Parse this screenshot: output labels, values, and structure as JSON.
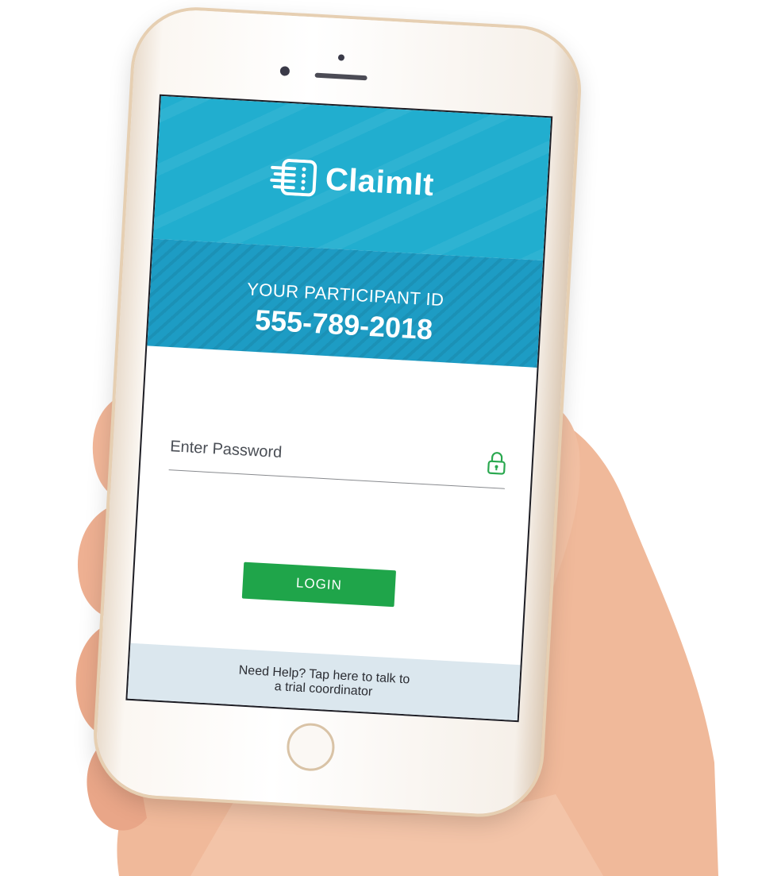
{
  "app": {
    "brand_name": "ClaimIt",
    "logo_icon": "document-list-icon",
    "accent_color": "#21aecf",
    "button_color": "#1fa54a"
  },
  "participant": {
    "label": "YOUR PARTICIPANT ID",
    "id": "555-789-2018"
  },
  "login_form": {
    "password_placeholder": "Enter Password",
    "password_value": "",
    "lock_icon": "lock-icon",
    "login_label": "LOGIN"
  },
  "help": {
    "line1": "Need Help? Tap here to talk to",
    "line2": "a trial coordinator"
  }
}
